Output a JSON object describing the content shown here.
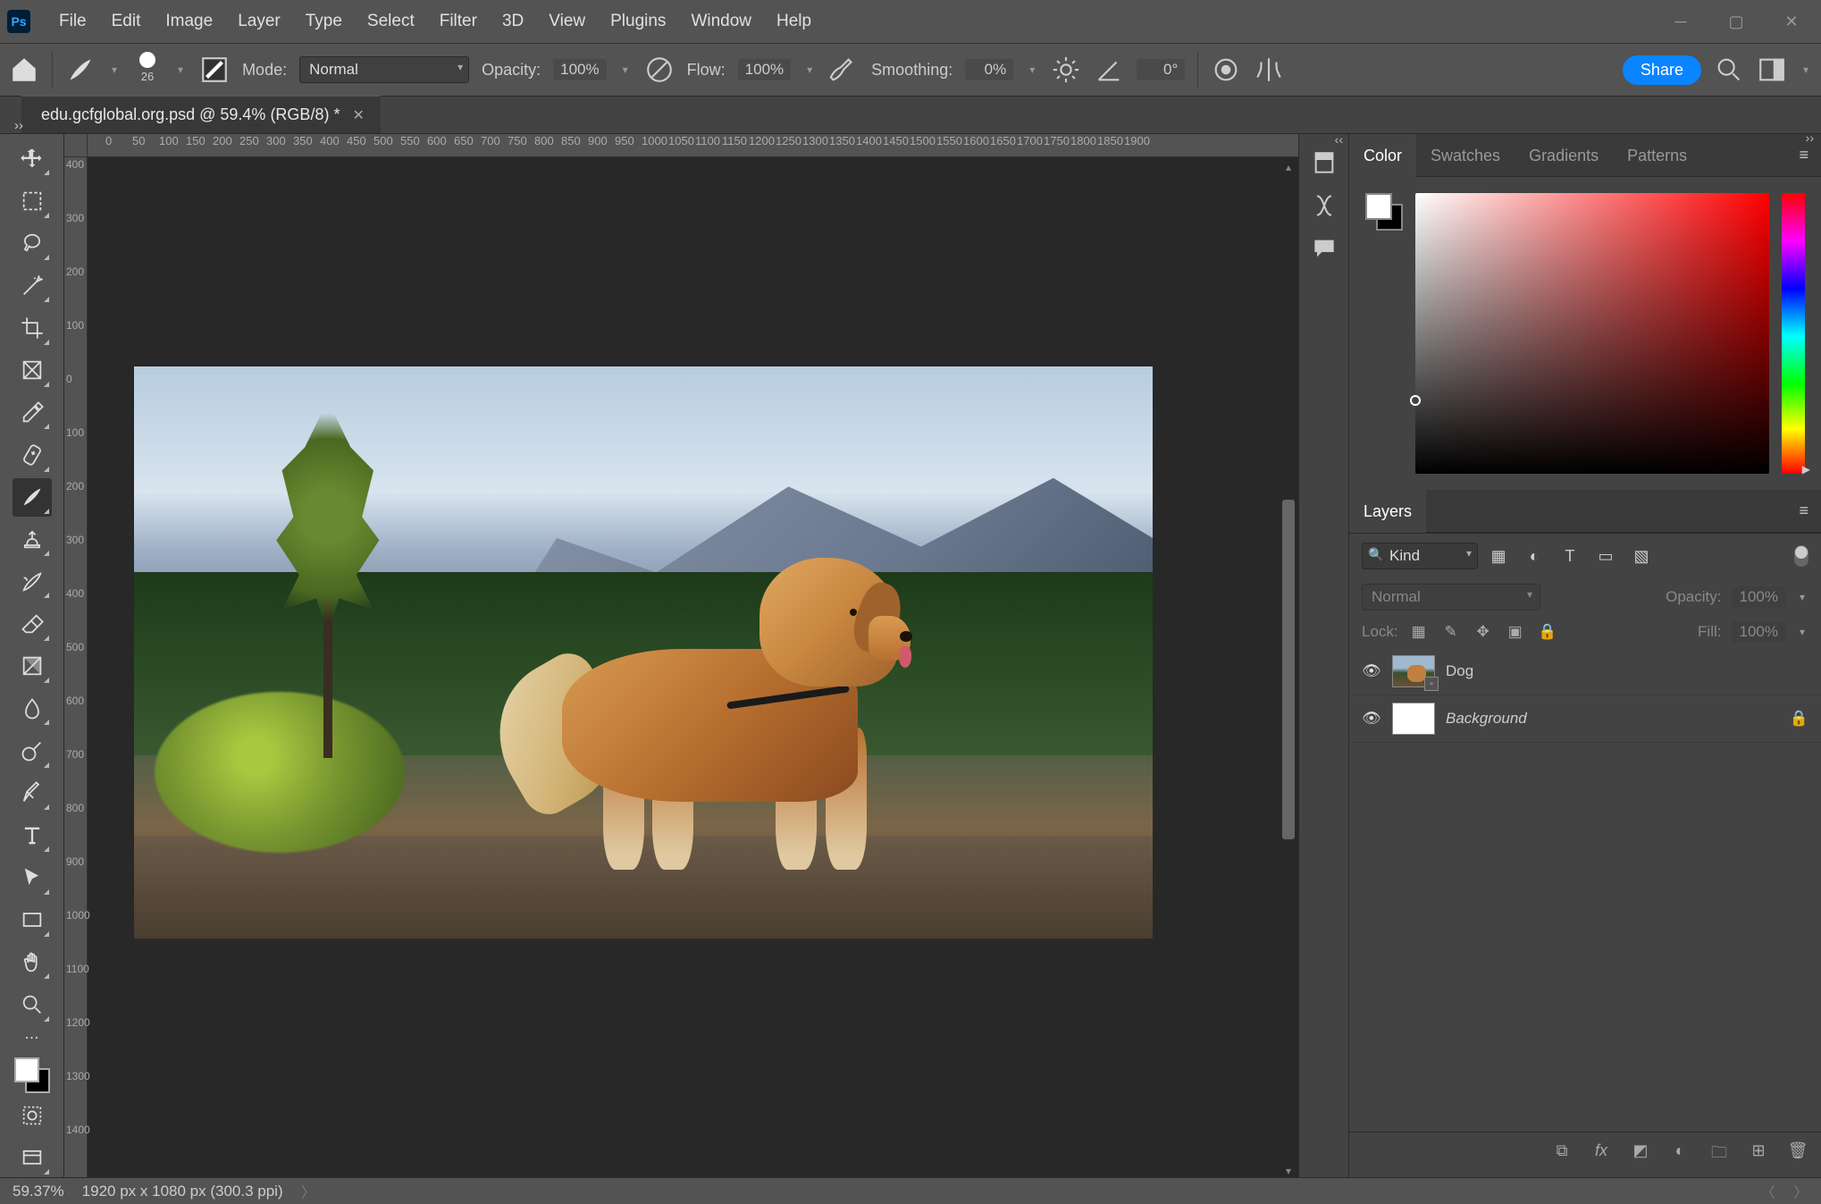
{
  "menu": [
    "File",
    "Edit",
    "Image",
    "Layer",
    "Type",
    "Select",
    "Filter",
    "3D",
    "View",
    "Plugins",
    "Window",
    "Help"
  ],
  "options": {
    "brush_size": "26",
    "mode_label": "Mode:",
    "mode_value": "Normal",
    "opacity_label": "Opacity:",
    "opacity_value": "100%",
    "flow_label": "Flow:",
    "flow_value": "100%",
    "smoothing_label": "Smoothing:",
    "smoothing_value": "0%",
    "angle_value": "0°",
    "share": "Share"
  },
  "tab": {
    "title": "edu.gcfglobal.org.psd @ 59.4% (RGB/8) *"
  },
  "ruler_h": [
    " ",
    "0",
    "50",
    "100",
    "150",
    "200",
    "250",
    "300",
    "350",
    "400",
    "450",
    "500",
    "550",
    "600",
    "650",
    "700",
    "750",
    "800",
    "850",
    "900",
    "950",
    "1000",
    "1050",
    "1100",
    "1150",
    "1200",
    "1250",
    "1300",
    "1350",
    "1400",
    "1450",
    "1500",
    "1550",
    "1600",
    "1650",
    "1700",
    "1750",
    "1800",
    "1850",
    "1900"
  ],
  "ruler_v": [
    "400",
    " ",
    "300",
    " ",
    "200",
    " ",
    "100",
    " ",
    "0",
    " ",
    "100",
    " ",
    "200",
    " ",
    "300",
    " ",
    "400",
    " ",
    "500",
    " ",
    "600",
    " ",
    "700",
    " ",
    "800",
    " ",
    "900",
    " ",
    "1000",
    " ",
    "1100",
    " ",
    "1200",
    " ",
    "1300",
    " ",
    "1400"
  ],
  "color_tabs": [
    "Color",
    "Swatches",
    "Gradients",
    "Patterns"
  ],
  "layers": {
    "tab": "Layers",
    "kind": "Kind",
    "blend_mode": "Normal",
    "opacity_label": "Opacity:",
    "opacity_value": "100%",
    "lock_label": "Lock:",
    "fill_label": "Fill:",
    "fill_value": "100%",
    "items": [
      {
        "name": "Dog",
        "smart": true
      },
      {
        "name": "Background",
        "locked": true
      }
    ]
  },
  "status": {
    "zoom": "59.37%",
    "dims": "1920 px x 1080 px (300.3 ppi)"
  }
}
